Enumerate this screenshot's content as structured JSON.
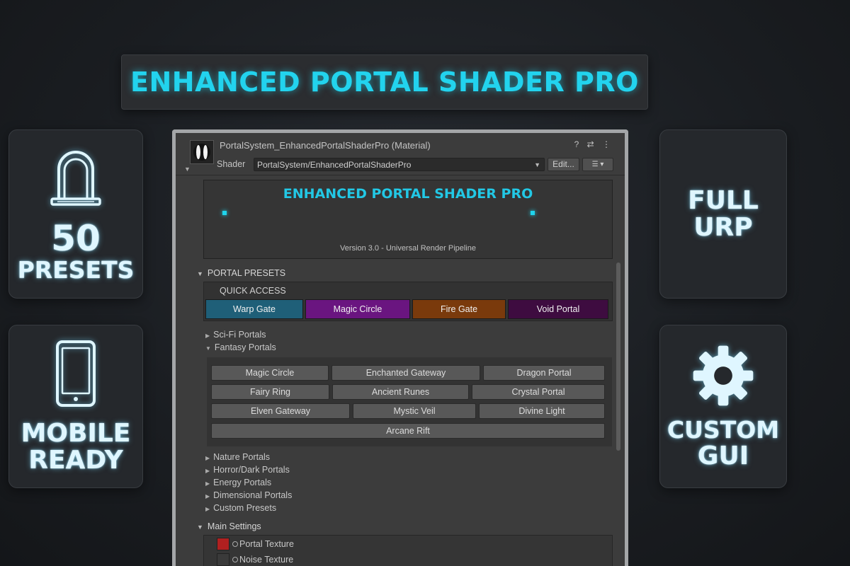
{
  "banner": {
    "title": "ENHANCED PORTAL SHADER PRO"
  },
  "cards": {
    "presets": {
      "icon": "portal-arch-icon",
      "line1": "50",
      "line2": "PRESETS"
    },
    "mobile": {
      "icon": "smartphone-icon",
      "line1": "MOBILE",
      "line2": "READY"
    },
    "urp": {
      "line1": "FULL",
      "line2": "URP"
    },
    "gui": {
      "icon": "gear-icon",
      "line1": "CUSTOM",
      "line2": "GUI"
    }
  },
  "inspector": {
    "material_title": "PortalSystem_EnhancedPortalShaderPro (Material)",
    "header_icons": "? ⇄ ⋮",
    "shader_label": "Shader",
    "shader_value": "PortalSystem/EnhancedPortalShaderPro",
    "edit_label": "Edit...",
    "menu_label": "☰ ▾",
    "banner_title": "ENHANCED PORTAL SHADER PRO",
    "version": "Version 3.0 - Universal Render Pipeline",
    "presets_header": "PORTAL PRESETS",
    "quick_access_label": "QUICK ACCESS",
    "quick_access": [
      {
        "label": "Warp Gate",
        "color": "#1f5f78"
      },
      {
        "label": "Magic Circle",
        "color": "#6a1580"
      },
      {
        "label": "Fire Gate",
        "color": "#7a3a0c"
      },
      {
        "label": "Void Portal",
        "color": "#3e0c40"
      }
    ],
    "categories_top": [
      {
        "label": "Sci-Fi Portals",
        "expanded": false
      },
      {
        "label": "Fantasy Portals",
        "expanded": true
      }
    ],
    "fantasy_presets": [
      "Magic Circle",
      "Enchanted Gateway",
      "Dragon Portal",
      "Fairy Ring",
      "Ancient Runes",
      "Crystal Portal",
      "Elven Gateway",
      "Mystic Veil",
      "Divine Light",
      "Arcane Rift"
    ],
    "categories_bottom": [
      "Nature Portals",
      "Horror/Dark Portals",
      "Energy Portals",
      "Dimensional Portals",
      "Custom Presets"
    ],
    "main_settings_header": "Main Settings",
    "textures": [
      {
        "label": "Portal Texture",
        "color": "#b02020"
      },
      {
        "label": "Noise Texture",
        "color": "#3a3a3a"
      }
    ]
  }
}
